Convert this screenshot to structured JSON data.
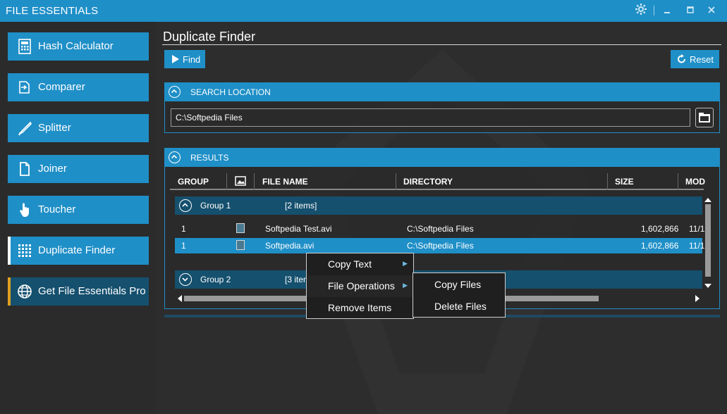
{
  "window": {
    "title": "FILE ESSENTIALS",
    "settings_icon": "gear-icon",
    "minimize_icon": "minimize-icon",
    "maximize_icon": "maximize-icon",
    "close_icon": "close-icon"
  },
  "sidebar": {
    "items": [
      {
        "label": "Hash Calculator",
        "icon": "calculator-icon"
      },
      {
        "label": "Comparer",
        "icon": "compare-icon"
      },
      {
        "label": "Splitter",
        "icon": "knife-icon"
      },
      {
        "label": "Joiner",
        "icon": "document-icon"
      },
      {
        "label": "Toucher",
        "icon": "hand-pointer-icon"
      },
      {
        "label": "Duplicate Finder",
        "icon": "grid-icon",
        "active": true
      },
      {
        "label": "Get File Essentials Pro",
        "icon": "globe-icon"
      }
    ]
  },
  "main": {
    "title": "Duplicate Finder",
    "find_label": "Find",
    "reset_label": "Reset",
    "search_location": {
      "header": "SEARCH LOCATION",
      "path": "C:\\Softpedia Files"
    },
    "results": {
      "header": "RESULTS",
      "columns": [
        "GROUP",
        "",
        "FILE NAME",
        "DIRECTORY",
        "SIZE",
        "MOD"
      ],
      "groups": [
        {
          "name": "Group 1",
          "count": "[2 items]",
          "rows": [
            {
              "group": "1",
              "name": "Softpedia Test.avi",
              "directory": "C:\\Softpedia Files",
              "size": "1,602,866",
              "modified": "11/1"
            },
            {
              "group": "1",
              "name": "Softpedia.avi",
              "directory": "C:\\Softpedia Files",
              "size": "1,602,866",
              "modified": "11/1",
              "selected": true
            }
          ]
        },
        {
          "name": "Group 2",
          "count": "[3 items]"
        }
      ]
    }
  },
  "context_menu": {
    "items": [
      {
        "label": "Copy Text",
        "has_submenu": true
      },
      {
        "label": "File Operations",
        "has_submenu": true
      },
      {
        "label": "Remove Items",
        "has_submenu": false
      }
    ],
    "submenu": [
      {
        "label": "Copy Files"
      },
      {
        "label": "Delete Files"
      }
    ]
  },
  "colors": {
    "accent": "#1f8fc7",
    "dark_accent": "#15506e",
    "background": "#2b2b2b",
    "pro_indicator": "#e0a020"
  }
}
